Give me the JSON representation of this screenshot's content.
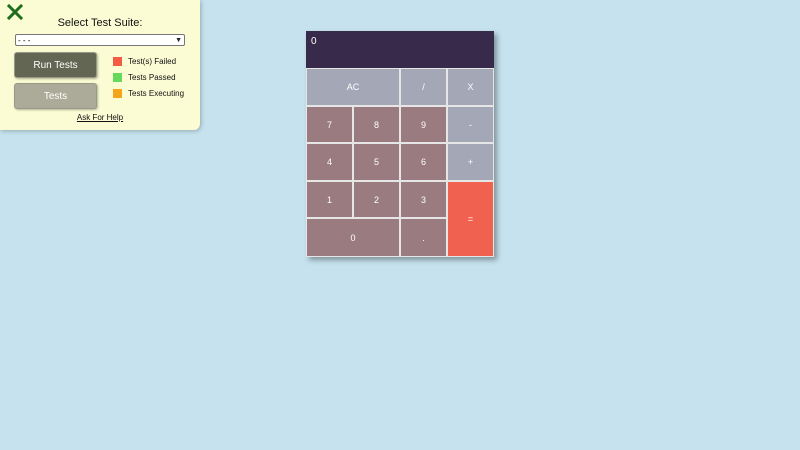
{
  "colors": {
    "background": "#c5e2ee",
    "panel": "#fbfcd4",
    "display": "#372a4a",
    "number_key": "#9a7b7f",
    "operator_key": "#a4a8b6",
    "equals_key": "#f06150",
    "failed": "#f35b44",
    "passed": "#66d95b",
    "executing": "#f4a51c",
    "close_icon": "#1e6e1e"
  },
  "test_panel": {
    "close_icon": "close-icon",
    "title": "Select Test Suite:",
    "suite_select": {
      "selected": "- - -"
    },
    "run_button": "Run Tests",
    "tests_button": "Tests",
    "legend": [
      {
        "label": "Test(s) Failed",
        "color": "#f35b44"
      },
      {
        "label": "Tests Passed",
        "color": "#66d95b"
      },
      {
        "label": "Tests Executing",
        "color": "#f4a51c"
      }
    ],
    "help_link": "Ask For Help"
  },
  "calculator": {
    "display_value": "0",
    "keys": {
      "clear": "AC",
      "divide": "/",
      "multiply": "X",
      "seven": "7",
      "eight": "8",
      "nine": "9",
      "subtract": "-",
      "four": "4",
      "five": "5",
      "six": "6",
      "add": "+",
      "one": "1",
      "two": "2",
      "three": "3",
      "equals": "=",
      "zero": "0",
      "decimal": "."
    }
  }
}
